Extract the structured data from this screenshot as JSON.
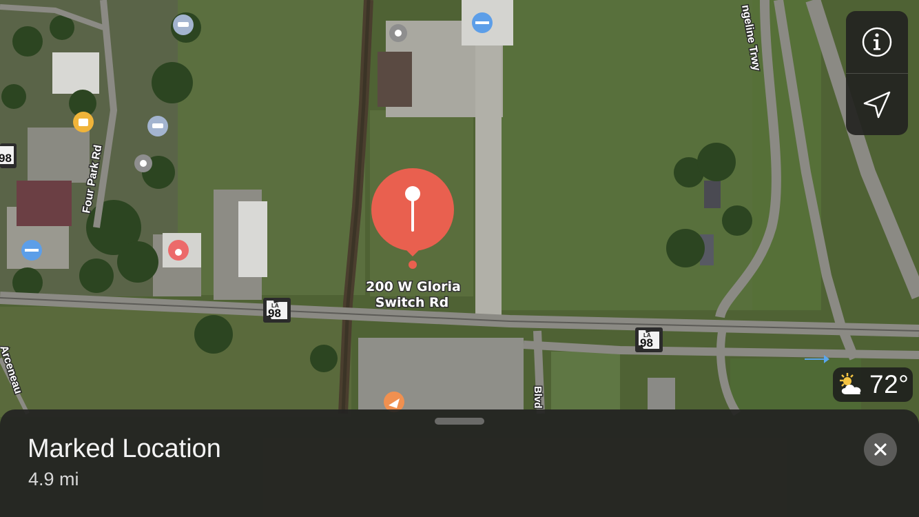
{
  "map": {
    "pin_label_line1": "200 W Gloria",
    "pin_label_line2": "Switch Rd",
    "pin_color": "#e9604f",
    "roads": {
      "four_park": "Four Park Rd",
      "evangeline": "ngeline Trwy",
      "arceneaux": "Arceneau",
      "blvd": "Blvd"
    },
    "shield_state": "LA",
    "shield_number": "98",
    "poi_icons": [
      "car-service-icon",
      "fitness-icon",
      "shopping-bag-icon",
      "pet-icon",
      "pizza-icon",
      "generic-poi-icon"
    ]
  },
  "controls": {
    "info_icon": "info-icon",
    "location_icon": "location-arrow-icon"
  },
  "weather": {
    "icon": "partly-sunny-icon",
    "temperature": "72°"
  },
  "sheet": {
    "title": "Marked Location",
    "distance": "4.9 mi",
    "close_icon": "close-icon"
  }
}
